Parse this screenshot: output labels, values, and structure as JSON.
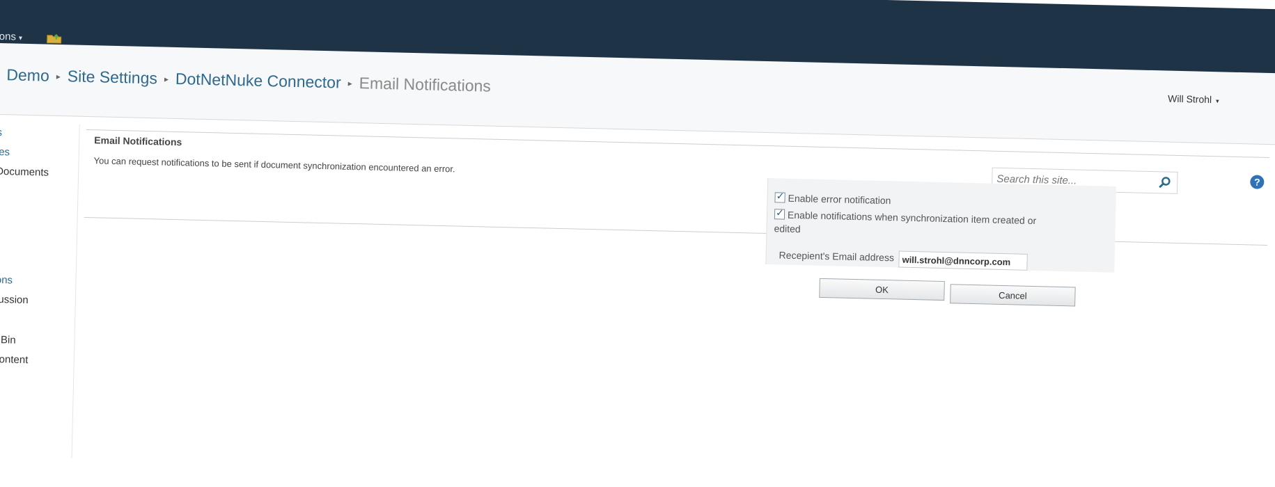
{
  "topbar": {
    "menu_label": "ons",
    "menu_caret": "▾",
    "folder_icon": "folder-up-icon"
  },
  "breadcrumb": {
    "items": [
      "Demo",
      "Site Settings",
      "DotNetNuke Connector"
    ],
    "current": "Email Notifications",
    "separator": "▸"
  },
  "user": {
    "name": "Will Strohl",
    "caret": "▾"
  },
  "search": {
    "placeholder": "Search this site...",
    "icon": "search-icon"
  },
  "help": {
    "icon": "help-icon"
  },
  "leftnav": {
    "items": [
      {
        "label": "s"
      },
      {
        "label": "ies"
      },
      {
        "label": "Documents"
      },
      {
        "label": "."
      },
      {
        "label": "ions"
      },
      {
        "label": "cussion"
      },
      {
        "label": "e Bin"
      },
      {
        "label": "Content"
      }
    ]
  },
  "main": {
    "title": "Email Notifications",
    "description": "You can request notifications to be sent if document synchronization encountered an error.",
    "options": {
      "enable_error": {
        "label": "Enable error notification",
        "checked": true
      },
      "enable_sync_line1": "Enable notifications when synchronization item created or",
      "enable_sync_line2": "edited",
      "email_label": "Recepient's Email address",
      "email_value": "will.strohl@dnncorp.com"
    },
    "buttons": {
      "ok": "OK",
      "cancel": "Cancel"
    }
  },
  "colors": {
    "topbar": "#1f3347",
    "link": "#2e6a8e",
    "panel": "#f2f3f4"
  }
}
